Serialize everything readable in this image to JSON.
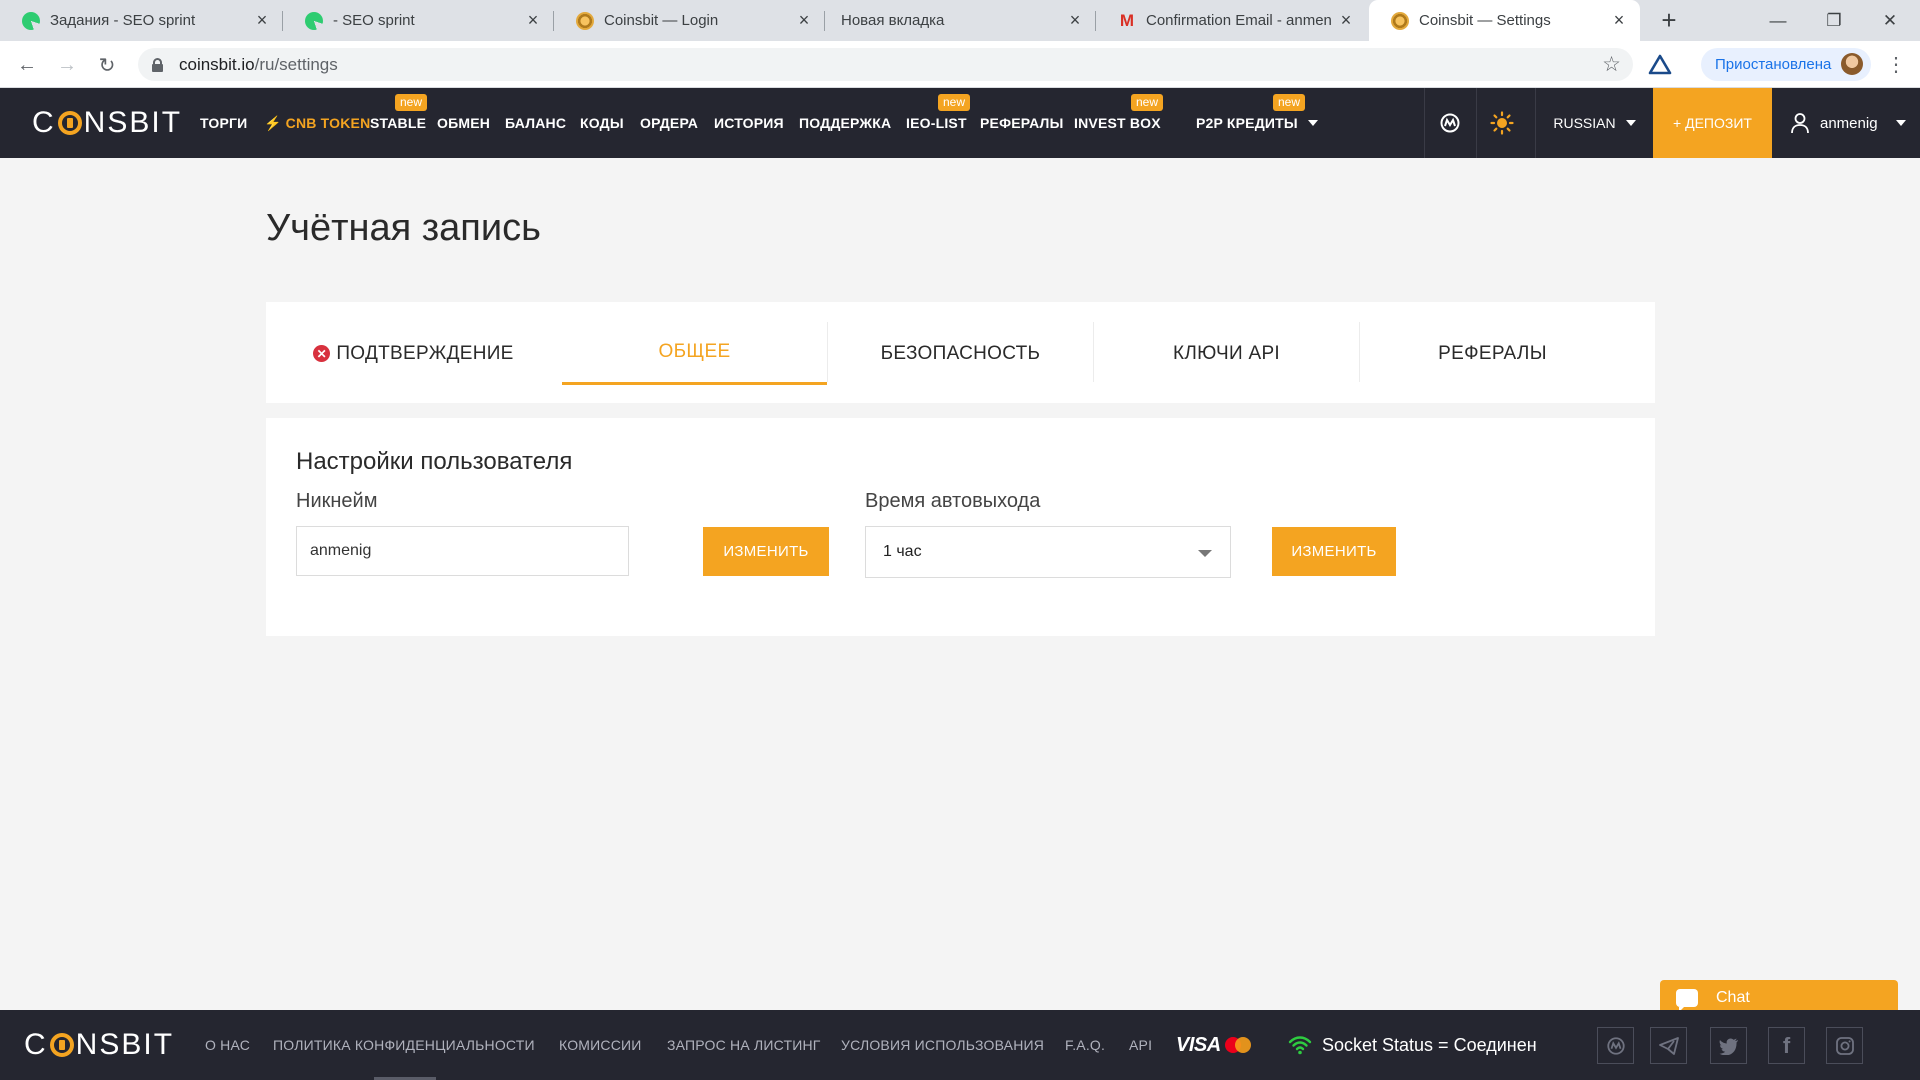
{
  "browser": {
    "tabs": [
      {
        "title": "Задания - SEO sprint",
        "favicon": "seo-sprint-icon"
      },
      {
        "title": "- SEO sprint",
        "favicon": "seo-sprint-icon"
      },
      {
        "title": "Coinsbit — Login",
        "favicon": "coinsbit-icon"
      },
      {
        "title": "Новая вкладка",
        "favicon": ""
      },
      {
        "title": "Confirmation Email - anmen",
        "favicon": "gmail-icon"
      },
      {
        "title": "Coinsbit — Settings",
        "favicon": "coinsbit-icon"
      }
    ],
    "active_tab": 5,
    "url_host": "coinsbit.io",
    "url_path": "/ru/settings",
    "profile_status": "Приостановлена"
  },
  "header": {
    "logo_left": "C",
    "logo_right": "NSBIT",
    "nav": [
      {
        "label": "ТОРГИ"
      },
      {
        "label": "CNB TOKEN",
        "accent": true
      },
      {
        "label": "STABLE",
        "badge": "new"
      },
      {
        "label": "ОБМЕН"
      },
      {
        "label": "БАЛАНС"
      },
      {
        "label": "КОДЫ"
      },
      {
        "label": "ОРДЕРА"
      },
      {
        "label": "ИСТОРИЯ"
      },
      {
        "label": "ПОДДЕРЖКА"
      },
      {
        "label": "IEO-LIST",
        "badge": "new"
      },
      {
        "label": "РЕФЕРАЛЫ"
      },
      {
        "label": "INVEST BOX",
        "badge": "new"
      },
      {
        "label": "P2P КРЕДИТЫ",
        "badge": "new"
      }
    ],
    "badge_text": "new",
    "language": "RUSSIAN",
    "deposit_label": "+ ДЕПОЗИТ",
    "username": "anmenig",
    "accent_color": "#f4a421",
    "bg_color": "#252630"
  },
  "page": {
    "title": "Учётная запись",
    "tabs": [
      {
        "label": "ПОДТВЕРЖДЕНИЕ",
        "status": "error"
      },
      {
        "label": "ОБЩЕЕ",
        "active": true
      },
      {
        "label": "БЕЗОПАСНОСТЬ"
      },
      {
        "label": "КЛЮЧИ API"
      },
      {
        "label": "РЕФЕРАЛЫ"
      }
    ]
  },
  "settings": {
    "section_title": "Настройки пользователя",
    "nickname_label": "Никнейм",
    "nickname_value": "anmenig",
    "nickname_button": "ИЗМЕНИТЬ",
    "autologout_label": "Время автовыхода",
    "autologout_value": "1 час",
    "autologout_button": "ИЗМЕНИТЬ"
  },
  "chat": {
    "label": "Chat"
  },
  "footer": {
    "links": [
      {
        "label": "О НАС"
      },
      {
        "label": "ПОЛИТИКА КОНФИДЕНЦИАЛЬНОСТИ"
      },
      {
        "label": "КОМИССИИ"
      },
      {
        "label": "ЗАПРОС НА ЛИСТИНГ"
      },
      {
        "label": "УСЛОВИЯ ИСПОЛЬЗОВАНИЯ"
      },
      {
        "label": "F.A.Q."
      },
      {
        "label": "API"
      }
    ],
    "payment_visa": "VISA",
    "socket_status": "Socket Status = Соединен",
    "socials": [
      "coinmarketcap-icon",
      "telegram-icon",
      "twitter-icon",
      "facebook-icon",
      "instagram-icon"
    ]
  }
}
